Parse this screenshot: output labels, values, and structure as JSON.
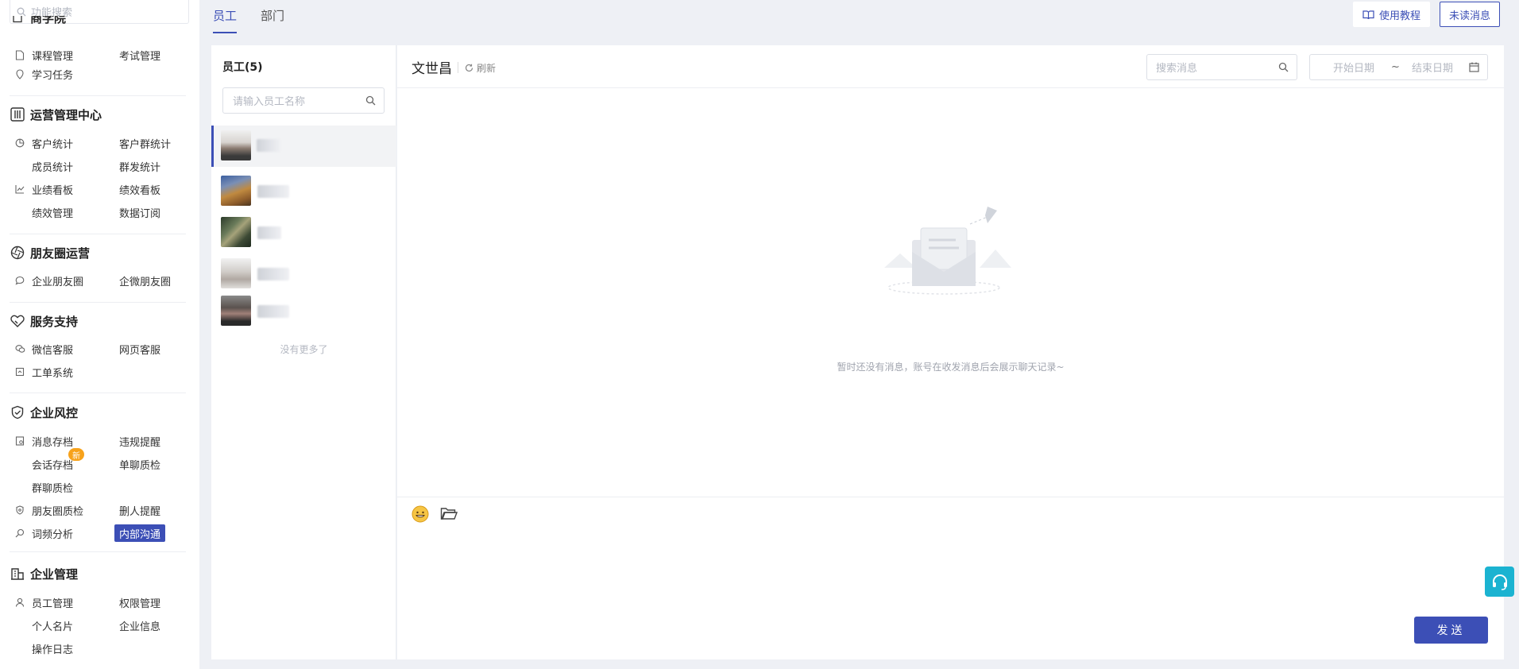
{
  "sidebar": {
    "search_placeholder": "功能搜索",
    "partial_header": "商学院",
    "academy": {
      "items": [
        "课程管理",
        "考试管理",
        "学习任务"
      ]
    },
    "operations": {
      "title": "运营管理中心",
      "items": [
        "客户统计",
        "客户群统计",
        "成员统计",
        "群发统计",
        "业绩看板",
        "绩效看板",
        "绩效管理",
        "数据订阅"
      ]
    },
    "moments": {
      "title": "朋友圈运营",
      "items": [
        "企业朋友圈",
        "企微朋友圈"
      ]
    },
    "service": {
      "title": "服务支持",
      "items": [
        "微信客服",
        "网页客服",
        "工单系统"
      ]
    },
    "risk": {
      "title": "企业风控",
      "items": [
        "消息存档",
        "违规提醒",
        "会话存档",
        "单聊质检",
        "群聊质检",
        "朋友圈质检",
        "删人提醒",
        "词频分析",
        "内部沟通"
      ],
      "new_badge": "新"
    },
    "enterprise": {
      "title": "企业管理",
      "items": [
        "员工管理",
        "权限管理",
        "个人名片",
        "企业信息",
        "操作日志"
      ]
    }
  },
  "tabs": [
    {
      "label": "员工",
      "active": true
    },
    {
      "label": "部门",
      "active": false
    }
  ],
  "top_buttons": {
    "tutorial": "使用教程",
    "unread": "未读消息"
  },
  "employee_panel": {
    "title": "员工(5)",
    "search_placeholder": "请输入员工名称",
    "no_more": "没有更多了"
  },
  "chat": {
    "contact_name": "文世昌",
    "refresh": "刷新",
    "search_placeholder": "搜索消息",
    "start_date": "开始日期",
    "date_sep": "~",
    "end_date": "结束日期",
    "empty_text": "暂时还没有消息，账号在收发消息后会展示聊天记录~",
    "send": "发送"
  },
  "colors": {
    "accent": "#3c4fb6",
    "badge": "#f7a21b",
    "support": "#1bb3d1"
  }
}
